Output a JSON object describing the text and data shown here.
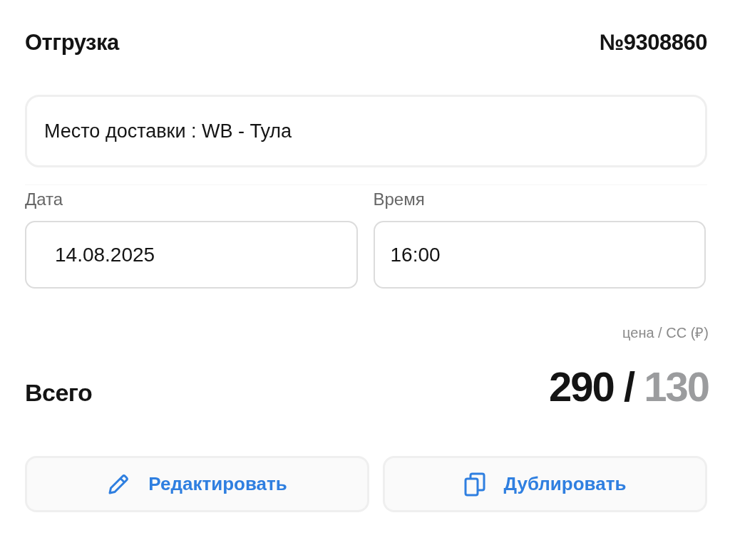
{
  "header": {
    "title": "Отгрузка",
    "number": "№9308860"
  },
  "delivery": {
    "text": "Место доставки : WB - Тула"
  },
  "fields": [
    {
      "label": "Дата",
      "value": "14.08.2025"
    },
    {
      "label": "Время",
      "value": "16:00"
    }
  ],
  "totals": {
    "caption": "цена / СС (₽)",
    "label": "Всего",
    "price": "290",
    "separator": "/",
    "cost": "130"
  },
  "buttons": [
    {
      "label": "Редактировать",
      "kind": "edit"
    },
    {
      "label": "Дублировать",
      "kind": "duplicate"
    }
  ]
}
